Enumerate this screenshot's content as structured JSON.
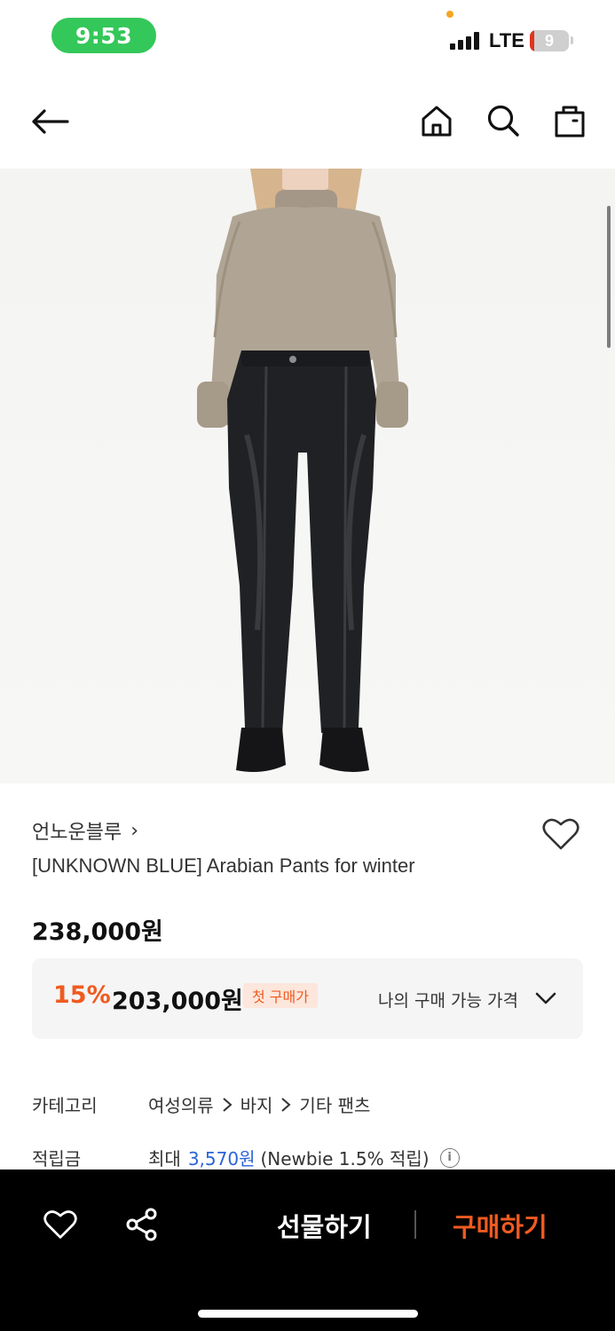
{
  "status_bar": {
    "time": "9:53",
    "network": "LTE",
    "battery": "9",
    "time_pill_color": "#34c759"
  },
  "nav": {
    "icons": [
      "arrow-left-icon",
      "home-icon",
      "search-icon",
      "shopping-bag-icon"
    ]
  },
  "product": {
    "brand": "언노운블루",
    "brand_chevron": "›",
    "name": "[UNKNOWN BLUE] Arabian Pants for winter",
    "original_price": "238,000원",
    "discount": "15%",
    "sale_price": "203,000원",
    "first_purchase_badge": "첫 구매가",
    "my_price_label": "나의 구매 가능 가격",
    "accent_color": "#ef5b20"
  },
  "info": {
    "category_label": "카테고리",
    "category_path": [
      "여성의류",
      "바지",
      "기타 팬츠"
    ],
    "points_label": "적립금",
    "points_prefix": "최대",
    "points_amount": "3,570원",
    "points_note": "(Newbie 1.5% 적립)"
  },
  "bottom_bar": {
    "gift_label": "선물하기",
    "buy_label": "구매하기",
    "icons": [
      "heart-icon",
      "share-icon"
    ]
  }
}
